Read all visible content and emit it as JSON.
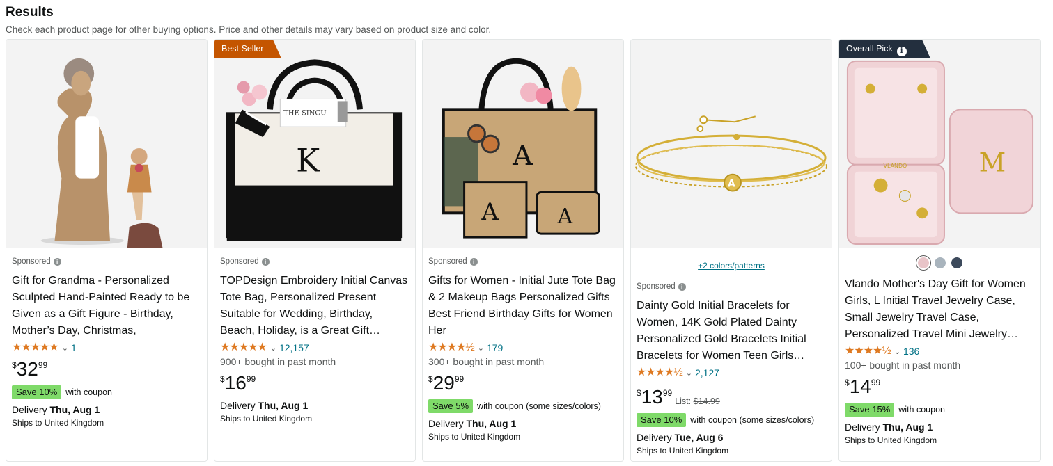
{
  "header": {
    "title": "Results",
    "subtitle": "Check each product page for other buying options. Price and other details may vary based on product size and color."
  },
  "products": [
    {
      "sponsored": "Sponsored",
      "title": "Gift for Grandma - Personalized Sculpted Hand-Painted Ready to be Given as a Gift Figure - Birthday, Mother’s Day, Christmas, Valentine's…",
      "stars": "★★★★★",
      "rating_count": "1",
      "price_symbol": "$",
      "price_whole": "32",
      "price_fraction": "99",
      "save_badge": "Save 10%",
      "coupon_text": "with coupon",
      "delivery_label": "Delivery ",
      "delivery_date": "Thu, Aug 1",
      "ships": "Ships to United Kingdom"
    },
    {
      "badge": "Best Seller",
      "sponsored": "Sponsored",
      "title": "TOPDesign Embroidery Initial Canvas Tote Bag, Personalized Present Suitable for Wedding, Birthday, Beach, Holiday, is a Great Gift…",
      "stars": "★★★★★",
      "rating_count": "12,157",
      "bought": "900+ bought in past month",
      "price_symbol": "$",
      "price_whole": "16",
      "price_fraction": "99",
      "delivery_label": "Delivery ",
      "delivery_date": "Thu, Aug 1",
      "ships": "Ships to United Kingdom",
      "image_letter": "K",
      "image_label": "THE SINGU"
    },
    {
      "sponsored": "Sponsored",
      "title": "Gifts for Women - Initial Jute Tote Bag & 2 Makeup Bags Personalized Gifts Best Friend Birthday Gifts for Women Her",
      "stars": "★★★★½",
      "rating_count": "179",
      "bought": "300+ bought in past month",
      "price_symbol": "$",
      "price_whole": "29",
      "price_fraction": "99",
      "save_badge": "Save 5%",
      "coupon_text": "with coupon (some sizes/colors)",
      "delivery_label": "Delivery ",
      "delivery_date": "Thu, Aug 1",
      "ships": "Ships to United Kingdom",
      "image_letter": "A"
    },
    {
      "colors_link": "+2 colors/patterns",
      "sponsored": "Sponsored",
      "title": "Dainty Gold Initial Bracelets for Women, 14K Gold Plated Dainty Personalized Gold Bracelets Initial Bracelets for Women Teen Girls…",
      "stars": "★★★★½",
      "rating_count": "2,127",
      "price_symbol": "$",
      "price_whole": "13",
      "price_fraction": "99",
      "list_label": "List: ",
      "list_price": "$14.99",
      "save_badge": "Save 10%",
      "coupon_text": "with coupon (some sizes/colors)",
      "delivery_label": "Delivery ",
      "delivery_date": "Tue, Aug 6",
      "ships": "Ships to United Kingdom",
      "image_letter": "A"
    },
    {
      "badge": "Overall Pick",
      "badge_info": "i",
      "swatch_colors": [
        "#e8c4c8",
        "#a9b4bd",
        "#3d4a5c"
      ],
      "title": "Vlando Mother's Day Gift for Women Girls, L Initial Travel Jewelry Case, Small Jewelry Travel Case, Personalized Travel Mini Jewelry…",
      "stars": "★★★★½",
      "rating_count": "136",
      "bought": "100+ bought in past month",
      "price_symbol": "$",
      "price_whole": "14",
      "price_fraction": "99",
      "save_badge": "Save 15%",
      "coupon_text": "with coupon",
      "delivery_label": "Delivery ",
      "delivery_date": "Thu, Aug 1",
      "ships": "Ships to United Kingdom",
      "image_letter": "M",
      "image_brand": "VLANDO"
    }
  ],
  "colors": {
    "accent_star": "#de7921",
    "link": "#007185",
    "save_badge_bg": "#7fda69",
    "best_seller_bg": "#c45500",
    "overall_pick_bg": "#232f3e"
  }
}
